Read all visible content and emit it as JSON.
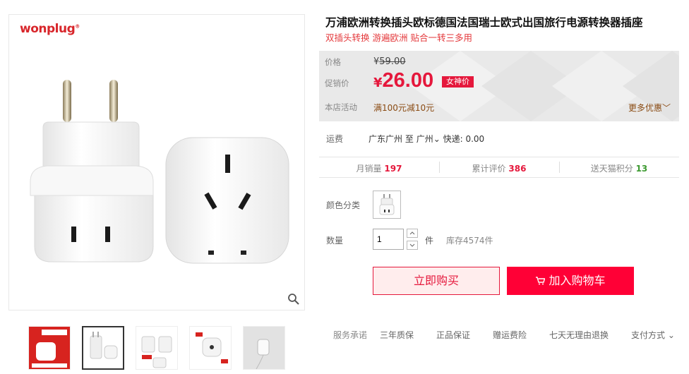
{
  "brand": {
    "name": "wonplug",
    "mark": "®"
  },
  "product": {
    "title": "万浦欧洲转换插头欧标德国法国瑞士欧式出国旅行电源转换器插座",
    "subtitle": "双插头转换 游遍欧洲 贴合一转三多用"
  },
  "price": {
    "label": "价格",
    "currency": "¥",
    "original": "59.00",
    "promo_label": "促销价",
    "promo_value": "26.00",
    "badge": "女神价",
    "activity_label": "本店活动",
    "activity": "满100元减10元",
    "more": "更多优惠"
  },
  "shipping": {
    "label": "运费",
    "from": "广东广州",
    "to_word": "至",
    "to": "广州",
    "express": "快递: 0.00"
  },
  "stats": [
    {
      "label": "月销量",
      "value": "197",
      "color": "#e5183c"
    },
    {
      "label": "累计评价",
      "value": "386",
      "color": "#e5183c"
    },
    {
      "label": "送天猫积分",
      "value": "13",
      "color": "#3d9a31"
    }
  ],
  "sku": {
    "label": "颜色分类"
  },
  "quantity": {
    "label": "数量",
    "value": "1",
    "unit": "件",
    "stock": "库存4574件"
  },
  "actions": {
    "buy": "立即购买",
    "cart_icon": "cart-icon",
    "cart": "加入购物车"
  },
  "service": {
    "label": "服务承诺",
    "items": [
      "三年质保",
      "正品保证",
      "赠运费险",
      "七天无理由退换"
    ],
    "payment": "支付方式"
  },
  "colors": {
    "accent": "#e5183c",
    "cart": "#ff0036",
    "brand": "#d8262b"
  }
}
